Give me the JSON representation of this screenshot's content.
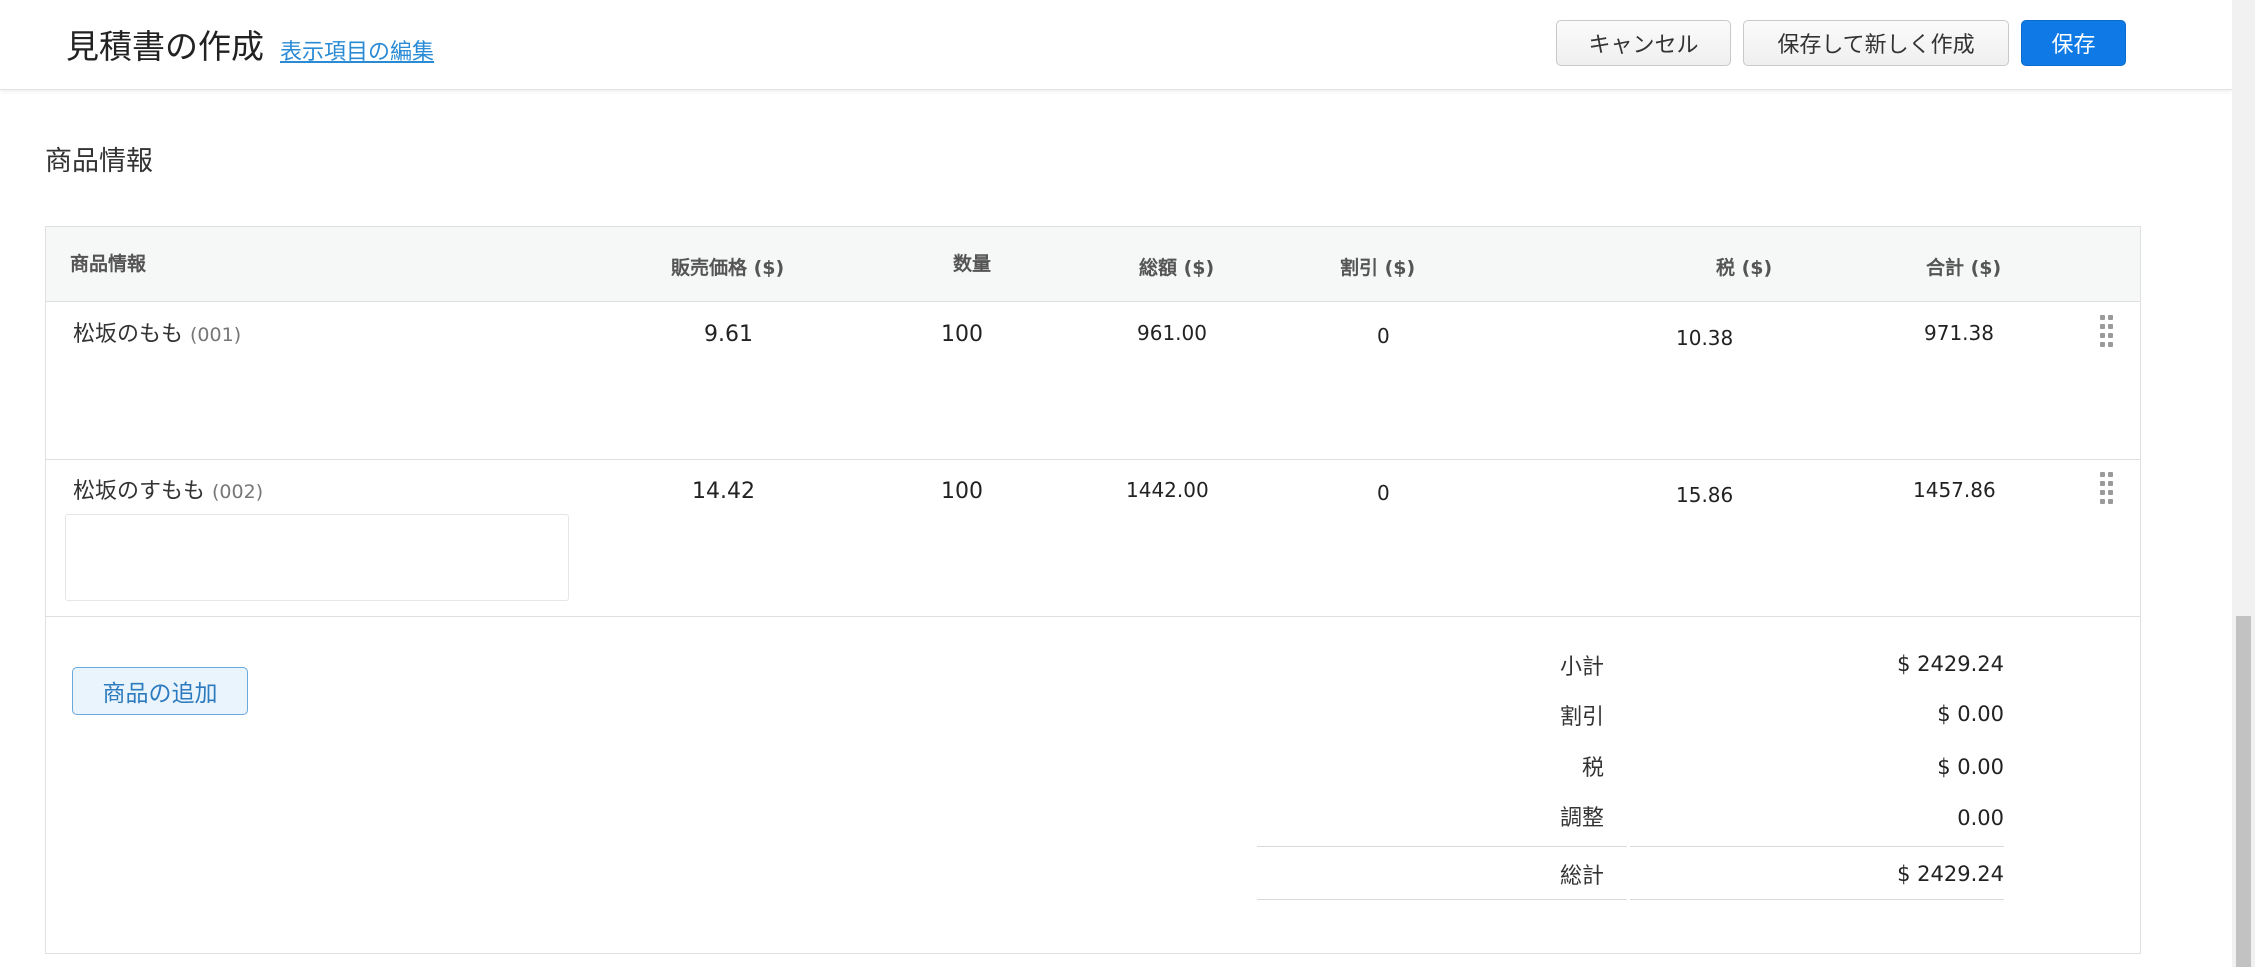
{
  "header": {
    "title": "見積書の作成",
    "edit_link": "表示項目の編集",
    "cancel_label": "キャンセル",
    "save_new_label": "保存して新しく作成",
    "save_label": "保存"
  },
  "section": {
    "title": "商品情報"
  },
  "table": {
    "headers": {
      "product": "商品情報",
      "price": "販売価格 ($)",
      "quantity": "数量",
      "total": "総額 ($)",
      "discount": "割引 ($)",
      "tax": "税 ($)",
      "amount": "合計 ($)"
    },
    "rows": [
      {
        "name": "松坂のもも",
        "code": "(001)",
        "price": "9.61",
        "quantity": "100",
        "total": "961.00",
        "discount": "0",
        "tax": "10.38",
        "amount": "971.38"
      },
      {
        "name": "松坂のすもも",
        "code": "(002)",
        "price": "14.42",
        "quantity": "100",
        "total": "1442.00",
        "discount": "0",
        "tax": "15.86",
        "amount": "1457.86"
      }
    ]
  },
  "add_product_label": "商品の追加",
  "summary": {
    "subtotal_label": "小計",
    "subtotal": "$ 2429.24",
    "discount_label": "割引",
    "discount": "$ 0.00",
    "tax_label": "税",
    "tax": "$ 0.00",
    "adjust_label": "調整",
    "adjust": "0.00",
    "grand_total_label": "総計",
    "grand_total": "$ 2429.24"
  },
  "colors": {
    "primary": "#0f7ae5",
    "link": "#2a8bd4"
  }
}
